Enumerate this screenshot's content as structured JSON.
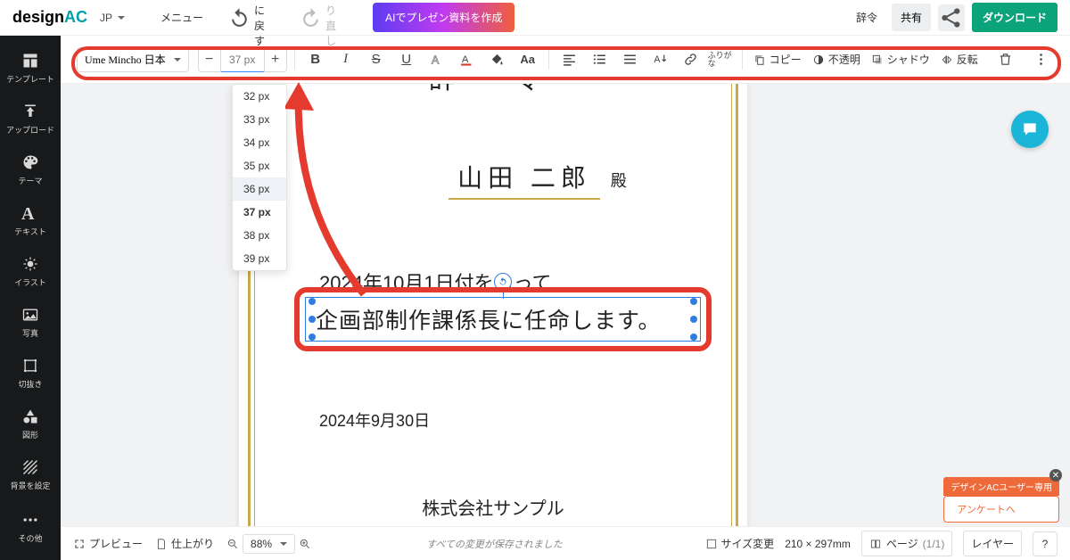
{
  "header": {
    "logo_a": "design",
    "logo_b": "AC",
    "lang": "JP",
    "menu": "メニュー",
    "undo": "元に戻す",
    "redo": "やり直し",
    "ai_btn": "AIでプレゼン資料を作成",
    "jirei": "辞令",
    "share": "共有",
    "download": "ダウンロード"
  },
  "sidebar": {
    "items": [
      {
        "label": "テンプレート"
      },
      {
        "label": "アップロード"
      },
      {
        "label": "テーマ"
      },
      {
        "label": "テキスト"
      },
      {
        "label": "イラスト"
      },
      {
        "label": "写真"
      },
      {
        "label": "切抜き"
      },
      {
        "label": "図形"
      },
      {
        "label": "背景を設定"
      },
      {
        "label": "その他"
      }
    ]
  },
  "toolbar": {
    "font": "Ume Mincho 日本",
    "size": "37 px",
    "copy": "コピー",
    "opacity": "不透明",
    "shadow": "シャドウ",
    "flip": "反転",
    "ruby": "ふりがな"
  },
  "size_dropdown": [
    "32 px",
    "33 px",
    "34 px",
    "35 px",
    "36 px",
    "37 px",
    "38 px",
    "39 px"
  ],
  "document": {
    "title": "辞　令",
    "name": "山田 二郎",
    "name_suffix": "殿",
    "line1": "2024年10月1日付をもって",
    "selected": "企画部制作課係長に任命します。",
    "date": "2024年9月30日",
    "company": "株式会社サンプル"
  },
  "bottombar": {
    "preview": "プレビュー",
    "finish": "仕上がり",
    "zoom": "88%",
    "status": "すべての変更が保存されました",
    "resize": "サイズ変更",
    "dims": "210 × 297mm",
    "page": "ページ",
    "page_count": "(1/1)",
    "layer": "レイヤー"
  },
  "survey": {
    "tag": "デザインACユーザー専用",
    "link": "アンケートへ"
  }
}
